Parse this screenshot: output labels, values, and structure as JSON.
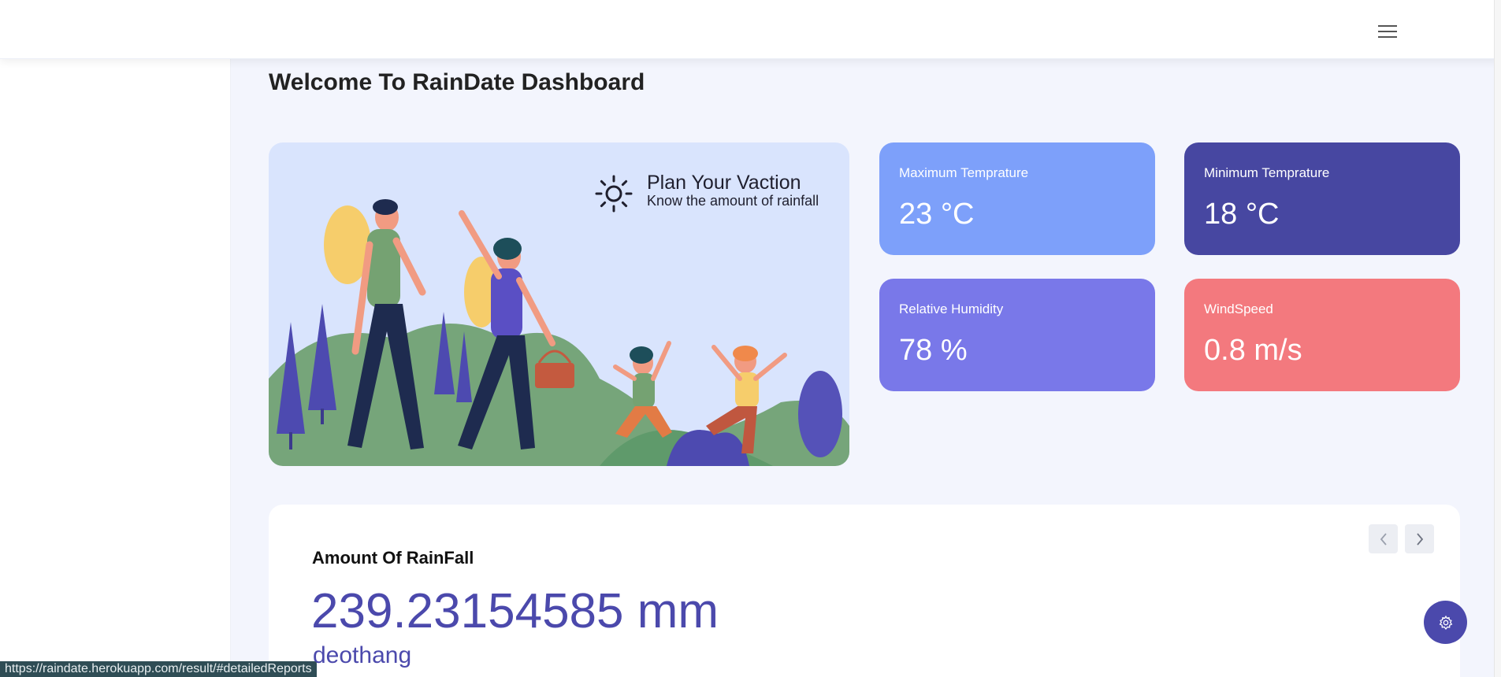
{
  "header": {
    "menu_icon": "hamburger-menu-icon"
  },
  "main": {
    "page_title": "Welcome To RainDate Dashboard"
  },
  "hero": {
    "icon": "sun-icon",
    "title": "Plan Your Vaction",
    "subtitle": "Know the amount of rainfall"
  },
  "stats": {
    "max_temp": {
      "label": "Maximum Temprature",
      "value": "23 °C",
      "color": "#7da0fa"
    },
    "min_temp": {
      "label": "Minimum Temprature",
      "value": "18 °C",
      "color": "#4747a1"
    },
    "humidity": {
      "label": "Relative Humidity",
      "value": "78 %",
      "color": "#7978e9"
    },
    "wind": {
      "label": "WindSpeed",
      "value": "0.8 m/s",
      "color": "#f3797e"
    }
  },
  "rainfall": {
    "title": "Amount Of RainFall",
    "value": "239.23154585 mm",
    "location": "deothang",
    "prev_icon": "chevron-left-icon",
    "next_icon": "chevron-right-icon"
  },
  "settings_fab": {
    "icon": "gear-icon"
  },
  "status_bar": {
    "url": "https://raindate.herokuapp.com/result/#detailedReports"
  },
  "colors": {
    "accent": "#4b49ac",
    "background": "#f3f5fd"
  }
}
